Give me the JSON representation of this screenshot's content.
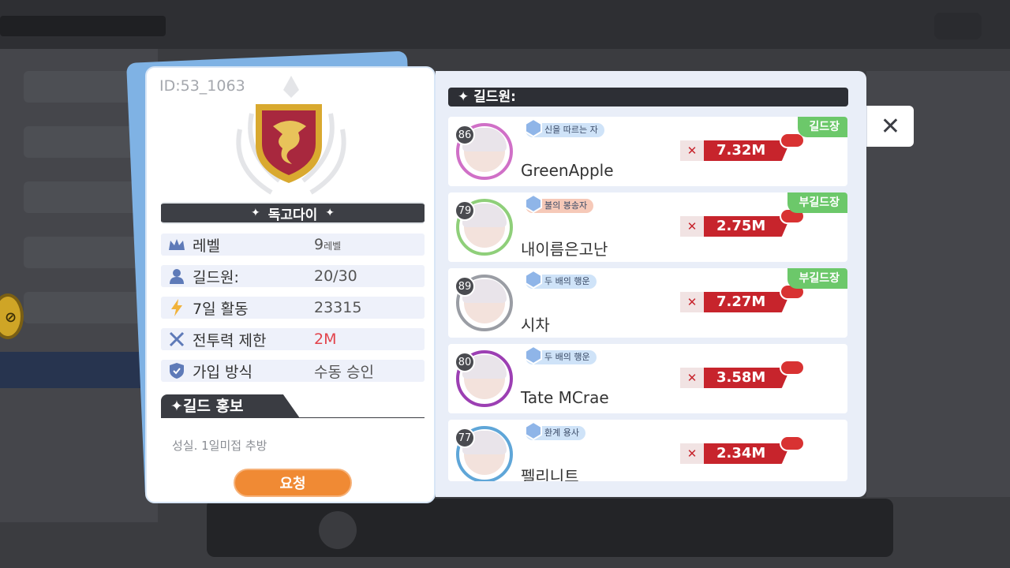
{
  "guild": {
    "id": "ID:53_1063",
    "name": "독고다이",
    "stats": [
      {
        "icon": "crown-icon",
        "label": "레벨",
        "value": "9",
        "unit": "레벨"
      },
      {
        "icon": "person-icon",
        "label": "길드원:",
        "value": "20/30",
        "unit": ""
      },
      {
        "icon": "lightning-icon",
        "label": "7일 활동",
        "value": "23315",
        "unit": ""
      },
      {
        "icon": "crossed-swords-icon",
        "label": "전투력 제한",
        "value": "2M",
        "unit": ""
      },
      {
        "icon": "shield-icon",
        "label": "가입 방식",
        "value": "수동 승인",
        "unit": ""
      }
    ],
    "promo_title": "✦길드 홍보",
    "promo_text": "성실. 1일미접 추방",
    "request_label": "요청"
  },
  "members_header": "✦ 길드원:",
  "members": [
    {
      "level": "86",
      "title": "신을 따르는 자",
      "name": "GreenApple",
      "power": "7.32M",
      "role": "길드장",
      "tag_color": "#cfe3f8",
      "ring": "#d070c7"
    },
    {
      "level": "79",
      "title": "불의 봉송자",
      "name": "내이름은고난",
      "power": "2.75M",
      "role": "부길드장",
      "tag_color": "#f6c9b8",
      "ring": "#8fcf7a"
    },
    {
      "level": "89",
      "title": "두 배의 행운",
      "name": "시차",
      "power": "7.27M",
      "role": "부길드장",
      "tag_color": "#cfe3f8",
      "ring": "#9a9da4"
    },
    {
      "level": "80",
      "title": "두 배의 행운",
      "name": "Tate MCrae",
      "power": "3.58M",
      "role": "",
      "tag_color": "#cfe3f8",
      "ring": "#9c3fb3"
    },
    {
      "level": "77",
      "title": "환계 용사",
      "name": "펠리니트",
      "power": "2.34M",
      "role": "",
      "tag_color": "#cfe3f8",
      "ring": "#5fa6d8"
    }
  ],
  "close_icon": "close-icon",
  "colors": {
    "accent": "#f08a34",
    "power": "#c7242c",
    "role": "#6cc86a",
    "limit": "#e2434b"
  }
}
